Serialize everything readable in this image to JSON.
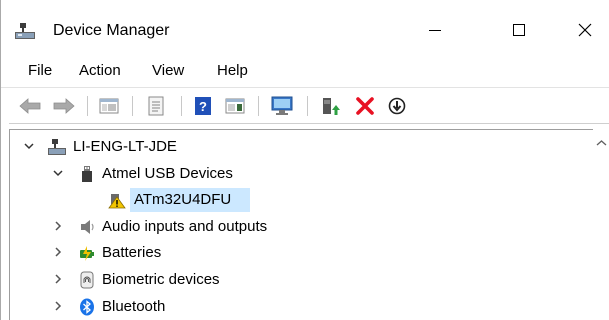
{
  "window": {
    "title": "Device Manager"
  },
  "menu": [
    {
      "label": "File"
    },
    {
      "label": "Action"
    },
    {
      "label": "View"
    },
    {
      "label": "Help"
    }
  ],
  "toolbar": {
    "icons": [
      "back-arrow-icon",
      "forward-arrow-icon",
      "show-hide-console-tree-icon",
      "properties-icon",
      "help-icon",
      "action-pane-icon",
      "scan-hardware-icon",
      "update-driver-icon",
      "uninstall-device-icon",
      "disable-device-icon"
    ]
  },
  "tree": {
    "root": "LI-ENG-LT-JDE",
    "items": [
      {
        "label": "Atmel USB Devices",
        "expanded": true
      },
      {
        "label": "ATm32U4DFU",
        "selected": true,
        "warning": true
      },
      {
        "label": "Audio inputs and outputs",
        "expanded": false
      },
      {
        "label": "Batteries",
        "expanded": false
      },
      {
        "label": "Biometric devices",
        "expanded": false
      },
      {
        "label": "Bluetooth",
        "expanded": false
      }
    ]
  },
  "colors": {
    "selection": "#cce8ff",
    "red_x": "#e81123",
    "help_blue": "#2050b8",
    "bluetooth_blue": "#1a73e8"
  }
}
